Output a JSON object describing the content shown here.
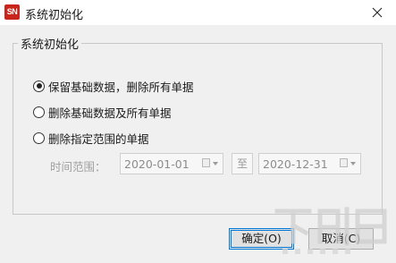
{
  "window": {
    "title": "系统初始化",
    "icon_text": "SN",
    "icon_color": "#c8251c"
  },
  "group": {
    "legend": "系统初始化"
  },
  "options": [
    {
      "label": "保留基础数据，删除所有单据",
      "checked": true
    },
    {
      "label": "删除基础数据及所有单据",
      "checked": false
    },
    {
      "label": "删除指定范围的单据",
      "checked": false
    }
  ],
  "date_range": {
    "label": "时间范围：",
    "start": "2020-01-01",
    "separator": "至",
    "end": "2020-12-31"
  },
  "buttons": {
    "ok": "确定(O)",
    "cancel": "取消(C)"
  },
  "colors": {
    "accent": "#0078d7",
    "disabled_text": "#a0a0a0"
  }
}
